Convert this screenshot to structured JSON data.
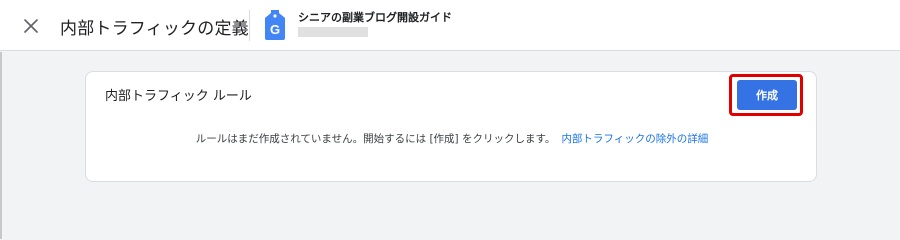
{
  "header": {
    "title": "内部トラフィックの定義",
    "close_icon": "close-icon",
    "property": {
      "name": "シニアの副業ブログ開設ガイド",
      "icon": "google-tag-icon",
      "icon_letter": "G",
      "icon_color": "#4285f4"
    }
  },
  "card": {
    "title": "内部トラフィック ルール",
    "create_button": "作成",
    "empty_message": "ルールはまだ作成されていません。開始するには [作成] をクリックします。",
    "learn_more_link": "内部トラフィックの除外の詳細"
  },
  "colors": {
    "primary": "#3572e4",
    "link": "#1a73e8",
    "highlight": "#e00000",
    "background": "#f1f3f4"
  }
}
